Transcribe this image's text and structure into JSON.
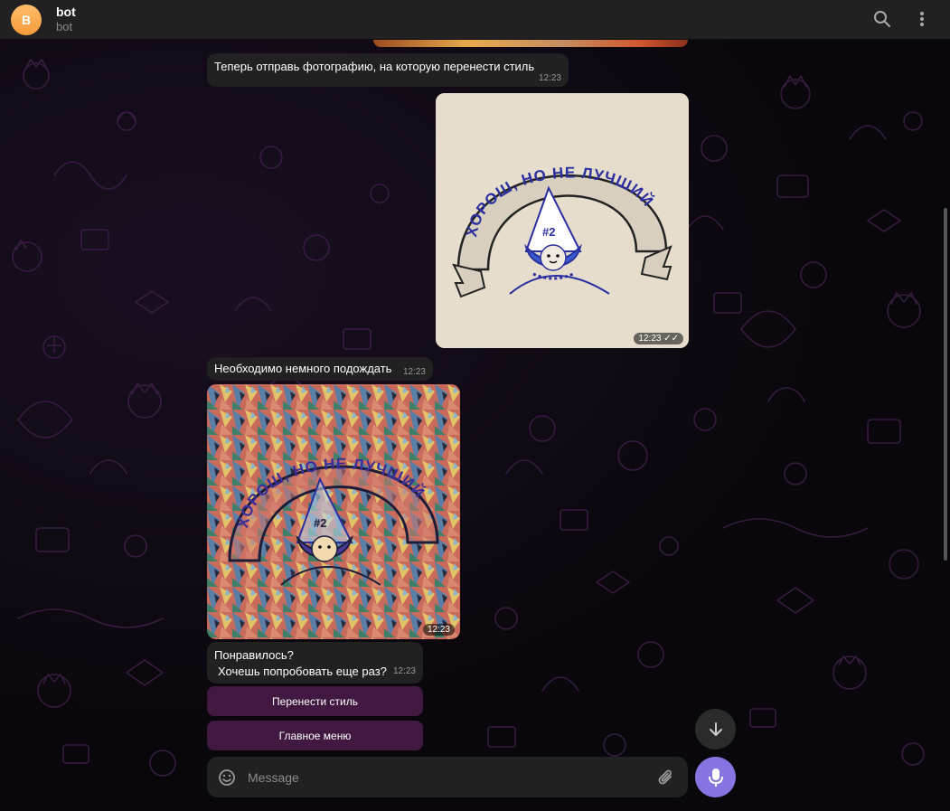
{
  "header": {
    "avatar_letter": "B",
    "title": "bot",
    "subtitle": "bot",
    "icons": [
      "search-icon",
      "more-vertical-icon"
    ]
  },
  "messages": [
    {
      "id": "m1",
      "side": "incoming",
      "text": "Теперь отправь фотографию, на которую перенести стиль",
      "time": "12:23"
    },
    {
      "id": "m2",
      "side": "outgoing",
      "type": "photo",
      "photo_text": "ХОРОШ, НО НЕ ЛУЧШИЙ",
      "badge": "#2",
      "time": "12:23",
      "status": "read"
    },
    {
      "id": "m3",
      "side": "incoming",
      "text": "Необходимо немного подождать",
      "time": "12:23"
    },
    {
      "id": "m4",
      "side": "incoming",
      "type": "photo",
      "photo_text": "ХОРОШ, НО НЕ ЛУЧШИЙ",
      "badge": "#2",
      "time": "12:23"
    },
    {
      "id": "m5",
      "side": "incoming",
      "line1": "Понравилось?",
      "line2": "Хочешь попробовать еще раз?",
      "time": "12:23"
    }
  ],
  "keyboard": {
    "buttons": [
      {
        "label": "Перенести стиль"
      },
      {
        "label": "Главное меню"
      }
    ]
  },
  "composer": {
    "placeholder": "Message",
    "value": ""
  },
  "colors": {
    "accent": "#8774e1",
    "bubble": "#212121",
    "keyboard_button": "#501e50",
    "avatar": "#f69a3a"
  }
}
